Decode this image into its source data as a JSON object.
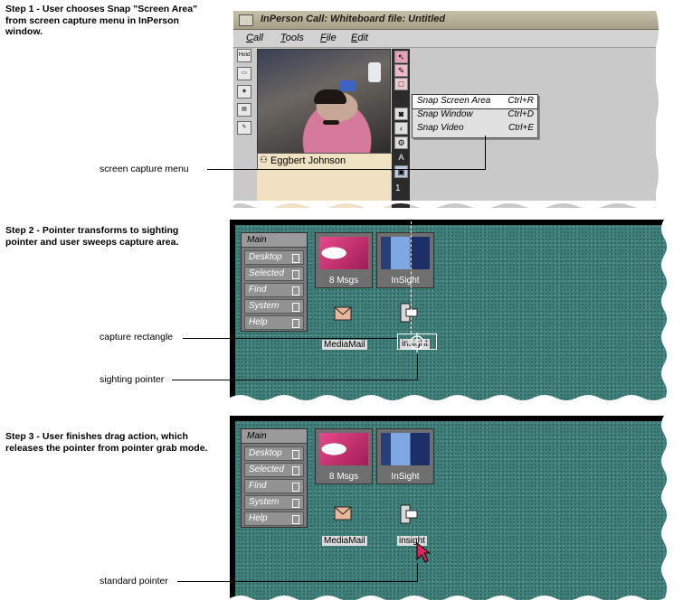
{
  "step1": {
    "caption": [
      "Step 1 - User chooses Snap \"Screen Area\"",
      "from screen capture menu in InPerson",
      "window."
    ],
    "callout": "screen capture menu",
    "window": {
      "title": "InPerson Call: Whiteboard file: Untitled",
      "menus": [
        "Call",
        "Tools",
        "File",
        "Edit"
      ],
      "participant_name": "Eggbert Johnson",
      "page_number": "1",
      "popup_items": [
        {
          "label": "Snap Screen Area",
          "accel": "Ctrl+R",
          "selected": true
        },
        {
          "label": "Snap Window",
          "accel": "Ctrl+D",
          "selected": false
        },
        {
          "label": "Snap Video",
          "accel": "Ctrl+E",
          "selected": false
        }
      ],
      "left_buttons": [
        "Hold",
        "",
        "",
        "",
        ""
      ]
    }
  },
  "step2": {
    "caption": [
      "Step 2 - Pointer transforms to sighting",
      "pointer and user sweeps capture area."
    ],
    "callouts": [
      "capture rectangle",
      "sighting pointer"
    ]
  },
  "step3": {
    "caption": [
      "Step 3 - User finishes drag action, which",
      "releases the pointer from pointer grab mode."
    ],
    "callouts": [
      "standard pointer"
    ]
  },
  "desktop": {
    "menu_title": "Main",
    "menu_items": [
      "Desktop",
      "Selected",
      "Find",
      "System",
      "Help"
    ],
    "icons": [
      "8 Msgs",
      "InSight"
    ],
    "small_icons": [
      "MediaMail",
      "insight"
    ]
  },
  "colors": {
    "desktop": "#3f7d78",
    "popup": "#e1e1e1",
    "pointer": "#e0245e"
  }
}
